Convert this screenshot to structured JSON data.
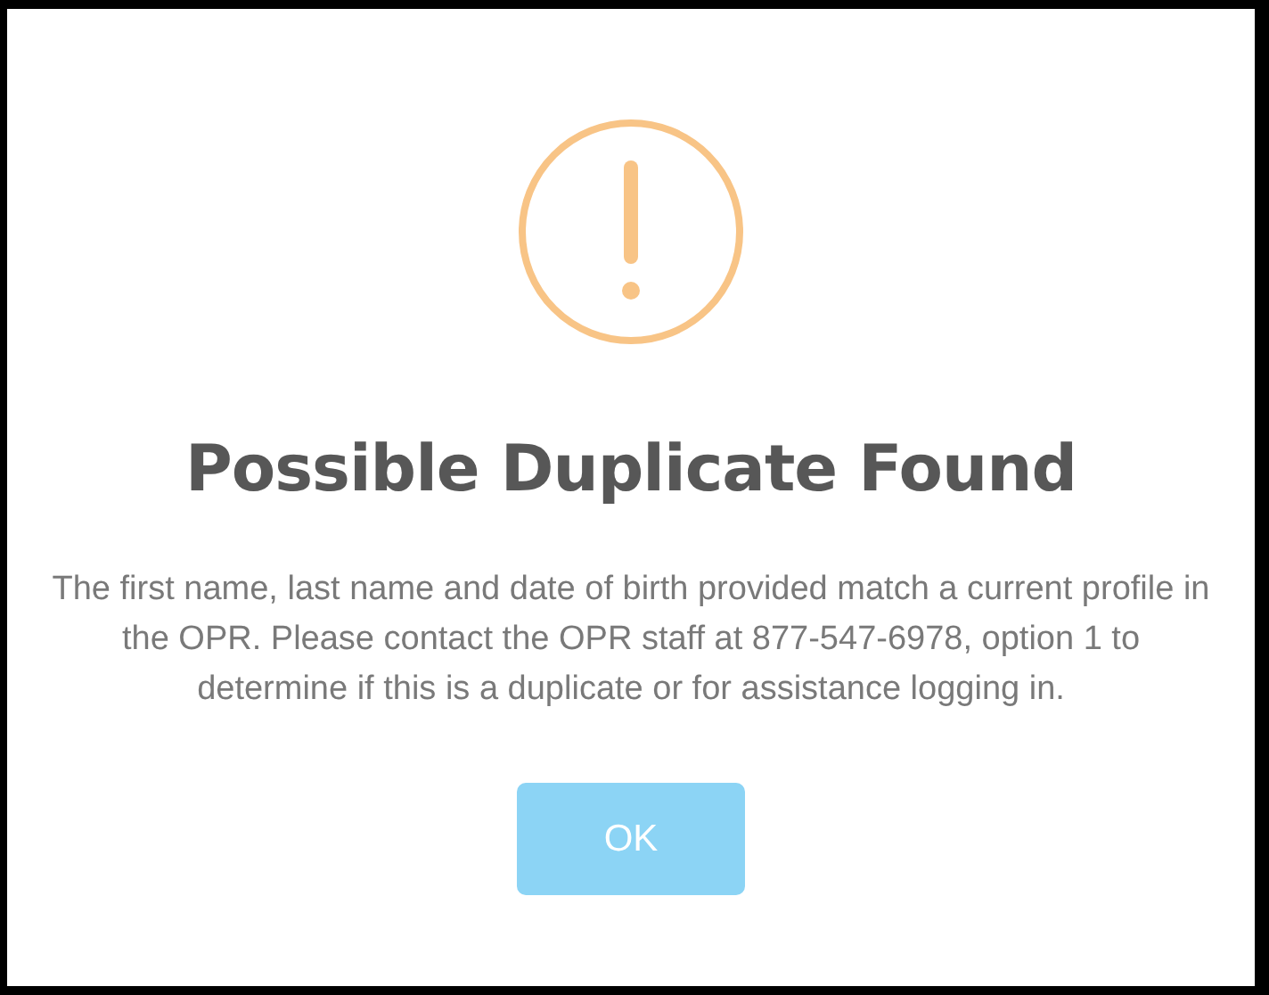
{
  "dialog": {
    "title": "Possible Duplicate Found",
    "message": "The first name, last name and date of birth provided match a current profile in the OPR. Please contact the OPR staff at 877-547-6978, option 1 to determine if this is a duplicate or for assistance logging in.",
    "buttons": [
      "OK"
    ]
  }
}
